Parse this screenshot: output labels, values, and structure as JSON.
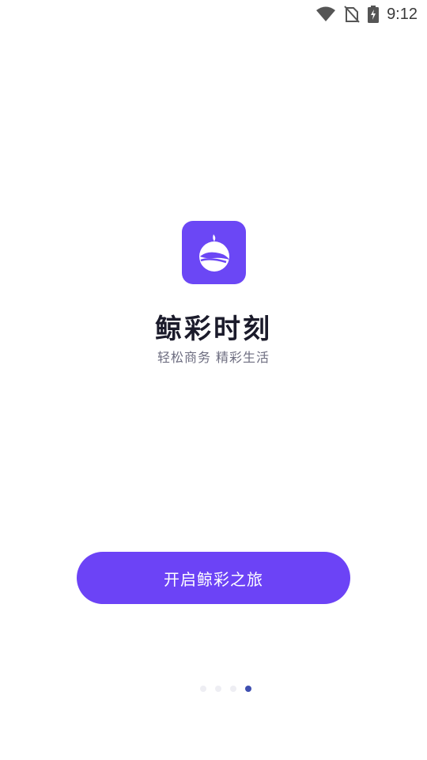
{
  "status_bar": {
    "time": "9:12",
    "icons": [
      "wifi-icon",
      "no-sim-icon",
      "battery-charging-icon"
    ]
  },
  "app": {
    "name": "鲸彩时刻",
    "slogan": "轻松商务 精彩生活",
    "logo_icon": "whale-fruit-logo-icon",
    "brand_color": "#6c43f6"
  },
  "start_button": {
    "label": "开启鲸彩之旅"
  },
  "page_indicator": {
    "total": 4,
    "active_index": 4,
    "active_color": "#3f4fb0",
    "inactive_color": "#eeeef3"
  }
}
